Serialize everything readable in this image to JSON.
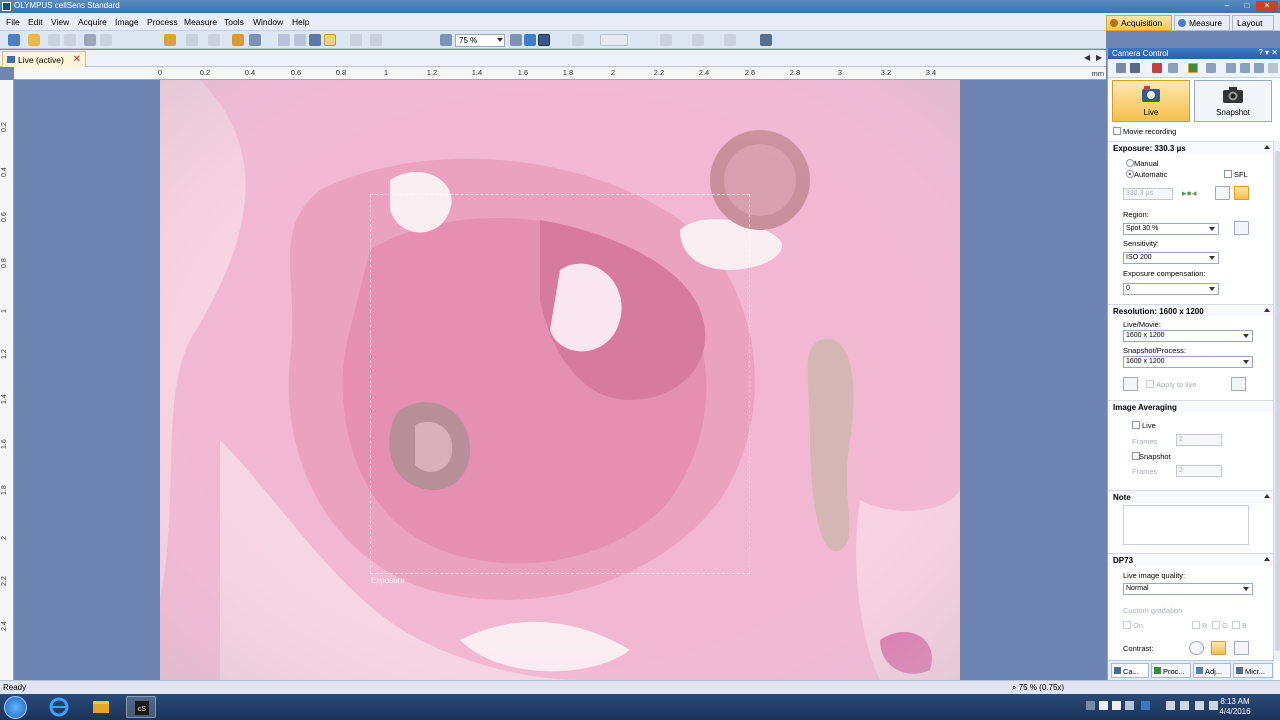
{
  "window": {
    "title": "OLYMPUS cellSens Standard"
  },
  "menu": [
    "File",
    "Edit",
    "View",
    "Acquire",
    "Image",
    "Process",
    "Measure",
    "Tools",
    "Window",
    "Help"
  ],
  "modes": [
    {
      "label": "Acquisition",
      "icon": "acquisition-icon",
      "active": true
    },
    {
      "label": "Measure",
      "icon": "measure-icon",
      "active": false
    },
    {
      "label": "Layout",
      "icon": "layout-icon",
      "active": false
    }
  ],
  "toolbar": {
    "zoom_value": "75 %"
  },
  "document": {
    "tab_label": "Live (active)"
  },
  "ruler": {
    "unit": "mm",
    "h_labels": [
      "0",
      "0.2",
      "0.4",
      "0.6",
      "0.8",
      "1",
      "1.2",
      "1.4",
      "1.6",
      "1.8",
      "2",
      "2.2",
      "2.4",
      "2.6",
      "2.8",
      "3",
      "3.2",
      "3.4"
    ],
    "v_labels": [
      "0.2",
      "0.4",
      "0.6",
      "0.8",
      "1",
      "1.2",
      "1.4",
      "1.6",
      "1.8",
      "2",
      "2.2",
      "2.4"
    ]
  },
  "canvas": {
    "roi_label": "Exposure"
  },
  "panel": {
    "title": "Camera Control",
    "live_label": "Live",
    "snapshot_label": "Snapshot",
    "movie_recording": "Movie recording",
    "exposure": {
      "header": "Exposure: 330.3 µs",
      "manual": "Manual",
      "automatic": "Automatic",
      "sfl": "SFL",
      "time_value": "330.3 µs",
      "region_label": "Region:",
      "region_value": "Spot 30 %",
      "sensitivity_label": "Sensitivity:",
      "sensitivity_value": "ISO 200",
      "compensation_label": "Exposure compensation:",
      "compensation_value": "0"
    },
    "resolution": {
      "header": "Resolution: 1600 x 1200",
      "live_label": "Live/Movie:",
      "live_value": "1600 x 1200",
      "snapshot_label": "Snapshot/Process:",
      "snapshot_value": "1600 x 1200",
      "apply_label": "Apply to live"
    },
    "averaging": {
      "header": "Image Averaging",
      "live": "Live",
      "frames_label": "Frames",
      "live_frames": "2",
      "snapshot": "Snapshot",
      "snapshot_frames": "2"
    },
    "note": {
      "header": "Note",
      "text": ""
    },
    "dp73": {
      "header": "DP73",
      "quality_label": "Live image quality:",
      "quality_value": "Normal",
      "custom_label": "Custom gradation",
      "on_label": "On",
      "r": "R",
      "g": "G",
      "b": "B",
      "contrast_label": "Contrast:"
    },
    "bottom_tabs": [
      "Ca...",
      "Proc...",
      "Adj...",
      "Micr..."
    ]
  },
  "status": {
    "ready": "Ready",
    "zoom": "75 % (0.75x)"
  },
  "taskbar": {
    "time": "8:13 AM",
    "date": "4/4/2016"
  },
  "colors": {
    "accent": "#f6bf4e",
    "titlebar": "#3f73aa",
    "canvas_bg": "#6d84b3",
    "tissue": "#f2b8d2"
  }
}
